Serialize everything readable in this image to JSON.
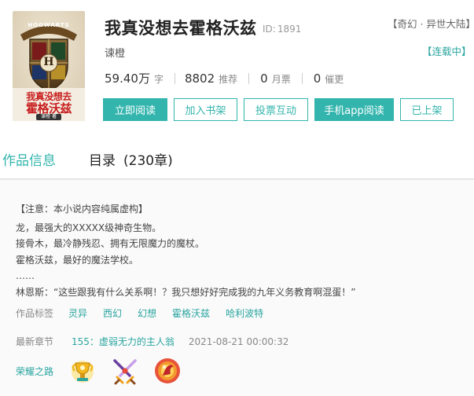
{
  "book": {
    "title": "我真没想去霍格沃兹",
    "id_label": "ID:",
    "id_value": "1891",
    "author": "谏橙",
    "genre": "【奇幻 · 异世大陆】",
    "status": "【连载中】",
    "cover": {
      "crest_text": "HOGWARTS",
      "crest_letter": "H",
      "title_line1": "我真没想去",
      "title_line2": "霍格沃兹",
      "author_tag": "谏橙 著"
    }
  },
  "stats": [
    {
      "value": "59.40万",
      "label": "字"
    },
    {
      "value": "8802",
      "label": "推荐"
    },
    {
      "value": "0",
      "label": "月票"
    },
    {
      "value": "0",
      "label": "催更"
    }
  ],
  "actions": {
    "read": "立即阅读",
    "shelf": "加入书架",
    "vote": "投票互动",
    "app": "手机app阅读",
    "listed": "已上架"
  },
  "tabs": {
    "info": "作品信息",
    "catalog": "目录",
    "catalog_count": "(230章)"
  },
  "description": {
    "notice": "【注意：本小说内容纯属虚构】",
    "lines": [
      "龙，最强大的XXXXX级神奇生物。",
      "接骨木，最冷静残忍、拥有无限魔力的魔杖。",
      "霍格沃兹，最好的魔法学校。",
      "……",
      "林恩斯：“这些跟我有什么关系啊！？我只想好好完成我的九年义务教育啊混蛋！”"
    ]
  },
  "tags": {
    "label": "作品标签",
    "items": [
      "灵异",
      "西幻",
      "幻想",
      "霍格沃兹",
      "哈利波特"
    ]
  },
  "latest": {
    "label": "最新章节",
    "chapter": "155：虚弱无力的主人翁",
    "time": "2021-08-21 00:00:32"
  },
  "honor": {
    "label": "荣耀之路",
    "badges": [
      "trophy-badge-icon",
      "crossed-swords-badge-icon",
      "flame-orb-badge-icon"
    ]
  },
  "colors": {
    "accent": "#33b5ad",
    "title_red": "#c81e1e"
  }
}
